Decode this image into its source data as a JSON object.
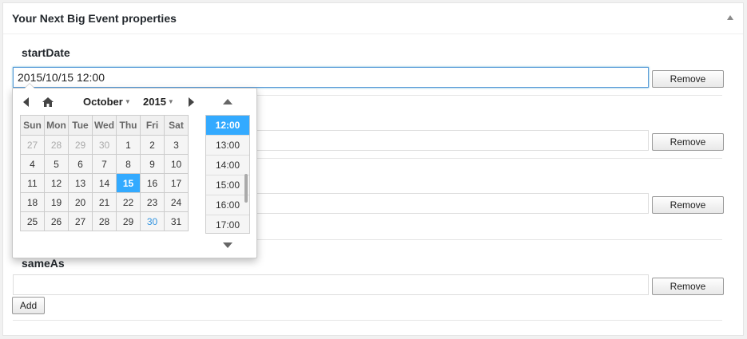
{
  "panel": {
    "title": "Your Next Big Event properties"
  },
  "fields": {
    "startDate": {
      "label": "startDate",
      "value": "2015/10/15 12:00",
      "remove_label": "Remove"
    },
    "row2": {
      "value": "",
      "remove_label": "Remove"
    },
    "row3": {
      "value": "",
      "remove_label": "Remove"
    },
    "sameAs": {
      "label": "sameAs",
      "value": "",
      "remove_label": "Remove",
      "add_label": "Add"
    }
  },
  "picker": {
    "month": "October",
    "year": "2015",
    "weekdays": [
      "Sun",
      "Mon",
      "Tue",
      "Wed",
      "Thu",
      "Fri",
      "Sat"
    ],
    "weeks": [
      [
        "27",
        "28",
        "29",
        "30",
        "1",
        "2",
        "3"
      ],
      [
        "4",
        "5",
        "6",
        "7",
        "8",
        "9",
        "10"
      ],
      [
        "11",
        "12",
        "13",
        "14",
        "15",
        "16",
        "17"
      ],
      [
        "18",
        "19",
        "20",
        "21",
        "22",
        "23",
        "24"
      ],
      [
        "25",
        "26",
        "27",
        "28",
        "29",
        "30",
        "31"
      ]
    ],
    "selected_day": "15",
    "today_day": "30",
    "times": [
      "12:00",
      "13:00",
      "14:00",
      "15:00",
      "16:00",
      "17:00"
    ],
    "selected_time": "12:00"
  },
  "colors": {
    "accent": "#33aaff",
    "focus_border": "#5b9dd9",
    "today": "#3394e0"
  }
}
